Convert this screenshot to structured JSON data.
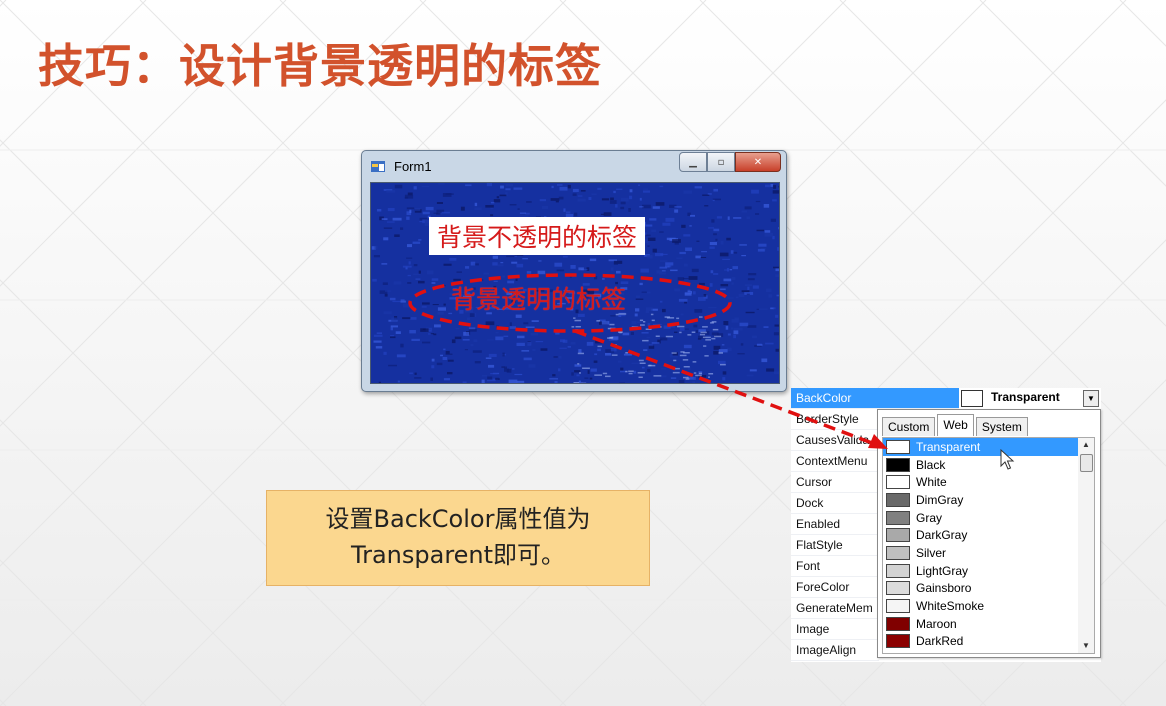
{
  "slide": {
    "title": "技巧：设计背景透明的标签"
  },
  "window": {
    "title": "Form1",
    "icon": "form-icon",
    "buttons": [
      "minimize-icon",
      "maximize-icon",
      "close-icon"
    ],
    "label_opaque": "背景不透明的标签",
    "label_transparent": "背景透明的标签",
    "client_color": "#1530a0"
  },
  "property_grid": {
    "selected_property": "BackColor",
    "selected_value": "Transparent",
    "properties": [
      "BorderStyle",
      "CausesValida",
      "ContextMenu",
      "Cursor",
      "Dock",
      "Enabled",
      "FlatStyle",
      "Font",
      "ForeColor",
      "GenerateMem",
      "Image",
      "ImageAlign"
    ],
    "tabs": [
      "Custom",
      "Web",
      "System"
    ],
    "active_tab": "Web",
    "colors": [
      {
        "name": "Transparent",
        "hex": "#ffffff",
        "selected": true
      },
      {
        "name": "Black",
        "hex": "#000000"
      },
      {
        "name": "White",
        "hex": "#ffffff"
      },
      {
        "name": "DimGray",
        "hex": "#696969"
      },
      {
        "name": "Gray",
        "hex": "#808080"
      },
      {
        "name": "DarkGray",
        "hex": "#a9a9a9"
      },
      {
        "name": "Silver",
        "hex": "#c0c0c0"
      },
      {
        "name": "LightGray",
        "hex": "#d3d3d3"
      },
      {
        "name": "Gainsboro",
        "hex": "#dcdcdc"
      },
      {
        "name": "WhiteSmoke",
        "hex": "#f5f5f5"
      },
      {
        "name": "Maroon",
        "hex": "#800000"
      },
      {
        "name": "DarkRed",
        "hex": "#8b0000"
      }
    ]
  },
  "note": {
    "line1": "设置BackColor属性值为",
    "line2": "Transparent即可。"
  },
  "colors": {
    "title": "#d2522c",
    "annotation": "#e01010",
    "note_bg": "#fbd78f",
    "selection": "#3399ff"
  }
}
